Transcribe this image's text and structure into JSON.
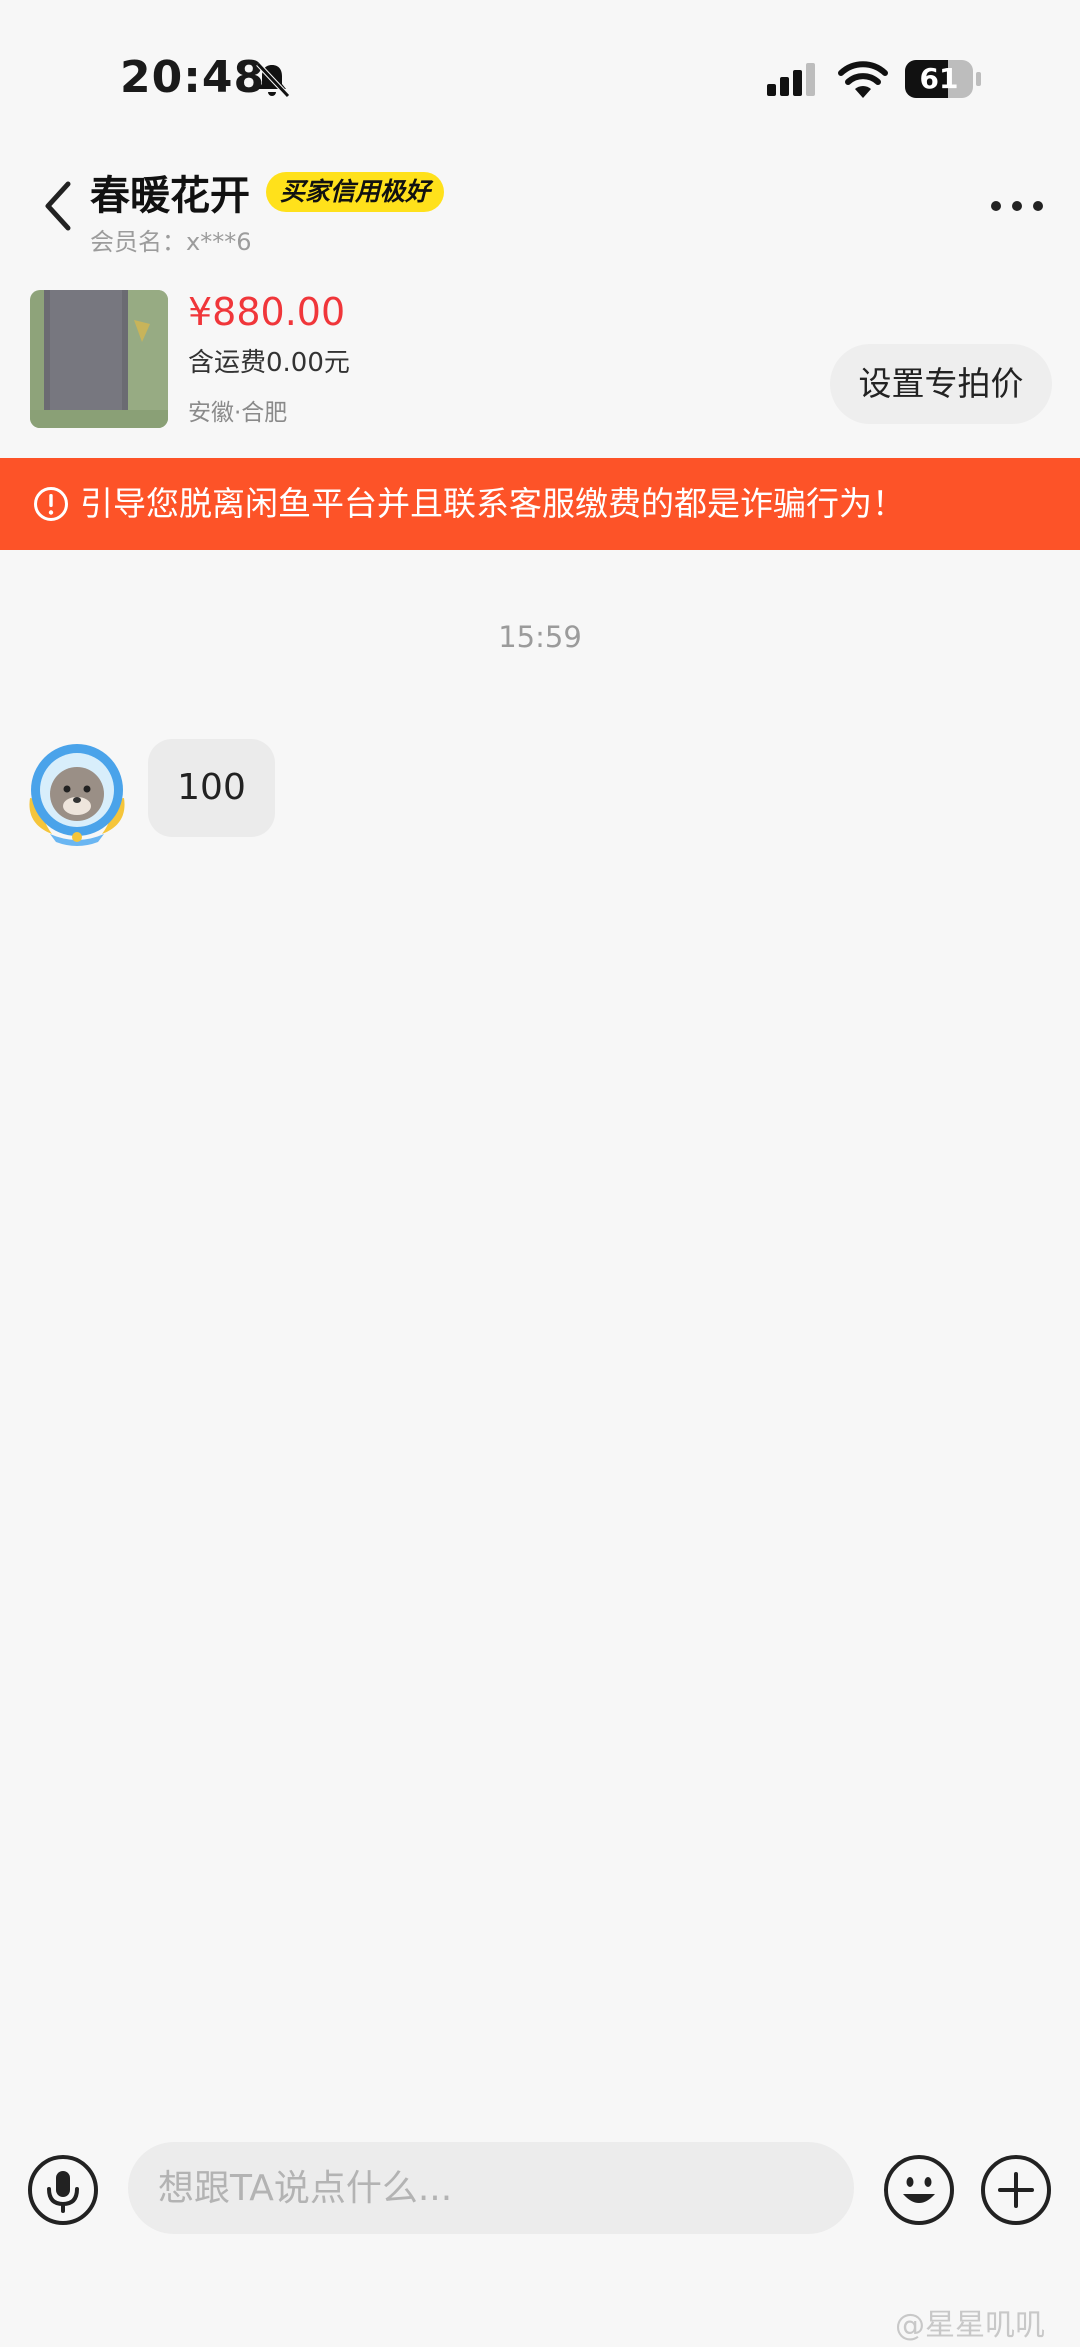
{
  "status_bar": {
    "time": "20:48",
    "battery_level": "61",
    "icons": [
      "bell-muted-icon",
      "cellular-signal-icon",
      "wifi-icon",
      "battery-icon"
    ]
  },
  "header": {
    "seller_name": "春暖花开",
    "credit_badge": "买家信用极好",
    "member_label": "会员名：x***6",
    "icons": [
      "back-chevron-icon",
      "more-dots-icon"
    ]
  },
  "product": {
    "price": "¥880.00",
    "shipping": "含运费0.00元",
    "location": "安徽·合肥",
    "special_price_button": "设置专拍价"
  },
  "warning": {
    "text": "引导您脱离闲鱼平台并且联系客服缴费的都是诈骗行为！",
    "icon": "exclamation-circle-icon"
  },
  "chat": {
    "timestamp": "15:59",
    "messages": [
      {
        "sender": "other",
        "text": "100"
      }
    ]
  },
  "input_bar": {
    "placeholder": "想跟TA说点什么...",
    "icons": [
      "microphone-icon",
      "emoji-icon",
      "plus-icon"
    ]
  },
  "watermark": "@星星叽叽",
  "colors": {
    "price": "#f0363a",
    "banner": "#fd5328",
    "badge": "#ffe11b",
    "background": "#f7f7f7"
  }
}
